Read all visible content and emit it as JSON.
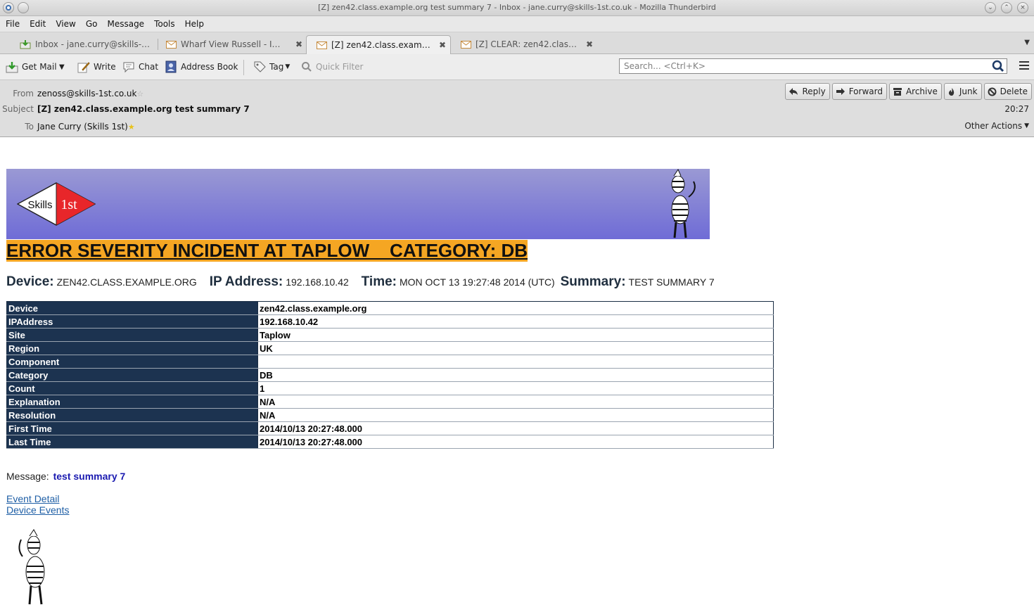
{
  "window": {
    "title": "[Z] zen42.class.example.org test summary 7 - Inbox - jane.curry@skills-1st.co.uk - Mozilla Thunderbird"
  },
  "menubar": {
    "items": [
      {
        "label": "File",
        "accel": "F"
      },
      {
        "label": "Edit",
        "accel": "E"
      },
      {
        "label": "View",
        "accel": "V"
      },
      {
        "label": "Go",
        "accel": "G"
      },
      {
        "label": "Message",
        "accel": "M"
      },
      {
        "label": "Tools",
        "accel": "T"
      },
      {
        "label": "Help",
        "accel": "H"
      }
    ]
  },
  "tabs": [
    {
      "label": "Inbox - jane.curry@skills-1st.co.uk",
      "icon": "inbox-icon",
      "active": false,
      "closable": false
    },
    {
      "label": "Wharf View Russell - Inbox",
      "icon": "envelope-icon",
      "active": false,
      "closable": true
    },
    {
      "label": "[Z] zen42.class.example.org test summary 7",
      "icon": "envelope-icon",
      "active": true,
      "closable": true
    },
    {
      "label": "[Z] CLEAR: zen42.class.example.org",
      "icon": "envelope-icon",
      "active": false,
      "closable": true
    }
  ],
  "toolbar": {
    "get_mail": "Get Mail",
    "write": "Write",
    "chat": "Chat",
    "address_book": "Address Book",
    "tag": "Tag",
    "quick_filter": "Quick Filter",
    "search_placeholder": "Search... <Ctrl+K>"
  },
  "header": {
    "from_label": "From",
    "from": "zenoss@skills-1st.co.uk",
    "subject_label": "Subject",
    "subject": "[Z] zen42.class.example.org test summary 7",
    "to_label": "To",
    "to": "Jane Curry (Skills 1st)",
    "time": "20:27",
    "other_actions": "Other Actions",
    "actions": {
      "reply": "Reply",
      "forward": "Forward",
      "archive": "Archive",
      "junk": "Junk",
      "delete": "Delete"
    }
  },
  "email": {
    "logo_text": "Skills",
    "logo_text_2": "1st",
    "severity_heading": "ERROR SEVERITY INCIDENT AT TAPLOW    CATEGORY: DB",
    "summary_line": {
      "device_label": "Device:",
      "device": "ZEN42.CLASS.EXAMPLE.ORG",
      "ip_label": "IP Address:",
      "ip": "192.168.10.42",
      "time_label": "Time:",
      "time": "MON OCT 13 19:27:48 2014 (UTC)",
      "summary_label": "Summary:",
      "summary": "TEST SUMMARY 7"
    },
    "table": [
      {
        "key": "Device",
        "value": "zen42.class.example.org"
      },
      {
        "key": "IPAddress",
        "value": "192.168.10.42"
      },
      {
        "key": "Site",
        "value": "Taplow"
      },
      {
        "key": "Region",
        "value": "UK"
      },
      {
        "key": "Component",
        "value": ""
      },
      {
        "key": "Category",
        "value": "DB"
      },
      {
        "key": "Count",
        "value": "1"
      },
      {
        "key": "Explanation",
        "value": "N/A"
      },
      {
        "key": "Resolution",
        "value": "N/A"
      },
      {
        "key": "First Time",
        "value": "2014/10/13 20:27:48.000"
      },
      {
        "key": "Last Time",
        "value": "2014/10/13 20:27:48.000"
      }
    ],
    "message_label": "Message:",
    "message": "test summary 7",
    "links": {
      "event_detail": "Event Detail",
      "device_events": "Device Events"
    }
  },
  "colors": {
    "banner_top": "#9a99d4",
    "banner_bottom": "#6f6cd6",
    "severity_bg": "#f5a623",
    "table_key_bg": "#1c3350",
    "link": "#1f5fa6"
  }
}
